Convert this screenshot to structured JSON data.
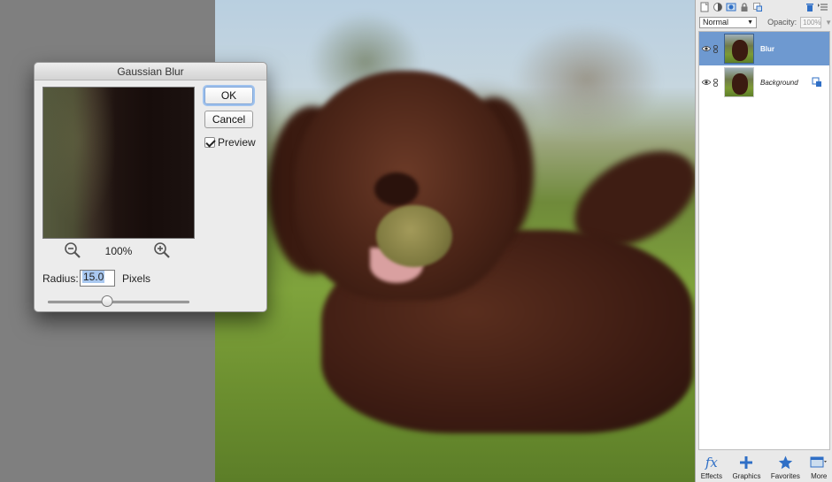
{
  "dialog": {
    "title": "Gaussian Blur",
    "ok_label": "OK",
    "cancel_label": "Cancel",
    "preview_label": "Preview",
    "preview_checked": true,
    "zoom_level": "100%",
    "radius_label": "Radius:",
    "radius_value": "15.0",
    "units_label": "Pixels",
    "slider_fraction": 0.42
  },
  "layers_panel": {
    "blend_mode": "Normal",
    "opacity_label": "Opacity:",
    "opacity_value": "100%",
    "layers": [
      {
        "name": "Blur",
        "selected": true
      },
      {
        "name": "Background",
        "selected": false
      }
    ],
    "bottom_buttons": [
      {
        "label": "Effects",
        "icon": "fx-icon"
      },
      {
        "label": "Graphics",
        "icon": "plus-icon"
      },
      {
        "label": "Favorites",
        "icon": "star-icon"
      },
      {
        "label": "More",
        "icon": "more-panel-icon"
      }
    ]
  },
  "colors": {
    "selection": "#6e99d0",
    "accent_icon": "#2f6fc6"
  }
}
